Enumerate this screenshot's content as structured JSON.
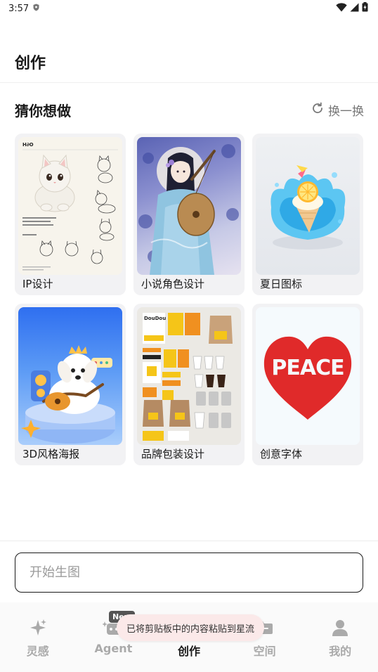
{
  "status_bar": {
    "time": "3:57"
  },
  "page": {
    "title": "创作"
  },
  "section": {
    "title": "猜你想做",
    "refresh_label": "换一换"
  },
  "cards": [
    {
      "label": "IP设计"
    },
    {
      "label": "小说角色设计"
    },
    {
      "label": "夏日图标"
    },
    {
      "label": "3D风格海报"
    },
    {
      "label": "品牌包装设计"
    },
    {
      "label": "创意字体"
    }
  ],
  "card_text": {
    "ip_brand": "H∂O",
    "brand_name": "DouDou",
    "peace_word": "PEACE"
  },
  "prompt": {
    "placeholder": "开始生图"
  },
  "tabs": [
    {
      "label": "灵感"
    },
    {
      "label": "Agent",
      "badge": "New"
    },
    {
      "label": "创作"
    },
    {
      "label": "空间"
    },
    {
      "label": "我的"
    }
  ],
  "toast": {
    "message": "已将剪贴板中的内容粘贴到星流"
  },
  "colors": {
    "accent": "#1a1a1a",
    "inactive": "#aaaaaa",
    "toast_bg": "#fbe9e9",
    "peace_red": "#e02a2a"
  }
}
